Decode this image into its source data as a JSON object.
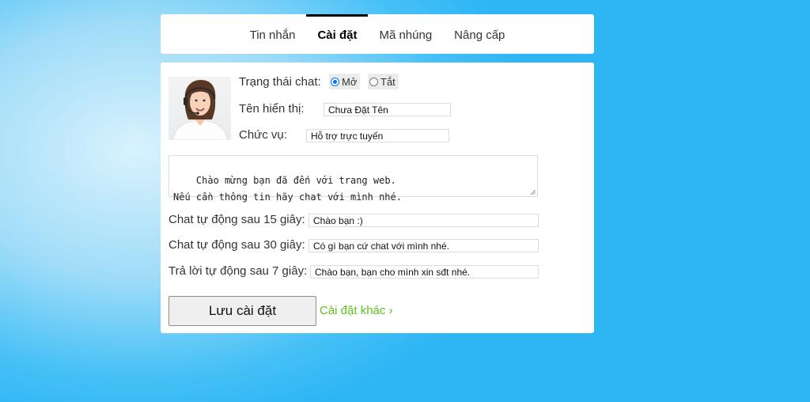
{
  "tabs": [
    {
      "label": "Tin nhắn",
      "active": false
    },
    {
      "label": "Cài đặt",
      "active": true
    },
    {
      "label": "Mã nhúng",
      "active": false
    },
    {
      "label": "Nâng cấp",
      "active": false
    }
  ],
  "settings": {
    "status_label": "Trạng thái chat:",
    "status_on_label": "Mở",
    "status_off_label": "Tắt",
    "status_selected": "on",
    "display_name_label": "Tên hiển thị:",
    "display_name_value": "Chưa Đặt Tên",
    "position_label": "Chức vụ:",
    "position_value": "Hỗ trợ trực tuyến",
    "welcome_message": "Chào mừng bạn đã đến với trang web.\nNếu cần thông tin hãy chat với mình nhé.",
    "auto_chat_15_label": "Chat tự động sau 15 giây:",
    "auto_chat_15_value": "Chào bạn :)",
    "auto_chat_30_label": "Chat tự động sau 30 giây:",
    "auto_chat_30_value": "Có gì bạn cứ chat với mình nhé.",
    "auto_reply_7_label": "Trả lời tự động sau 7 giây:",
    "auto_reply_7_value": "Chào bạn, bạn cho mình xin sđt nhé."
  },
  "actions": {
    "save_label": "Lưu cài đặt",
    "more_settings_label": "Cài đặt khác ›"
  },
  "colors": {
    "accent_link": "#5ec31a",
    "radio_checked": "#0075ff"
  }
}
